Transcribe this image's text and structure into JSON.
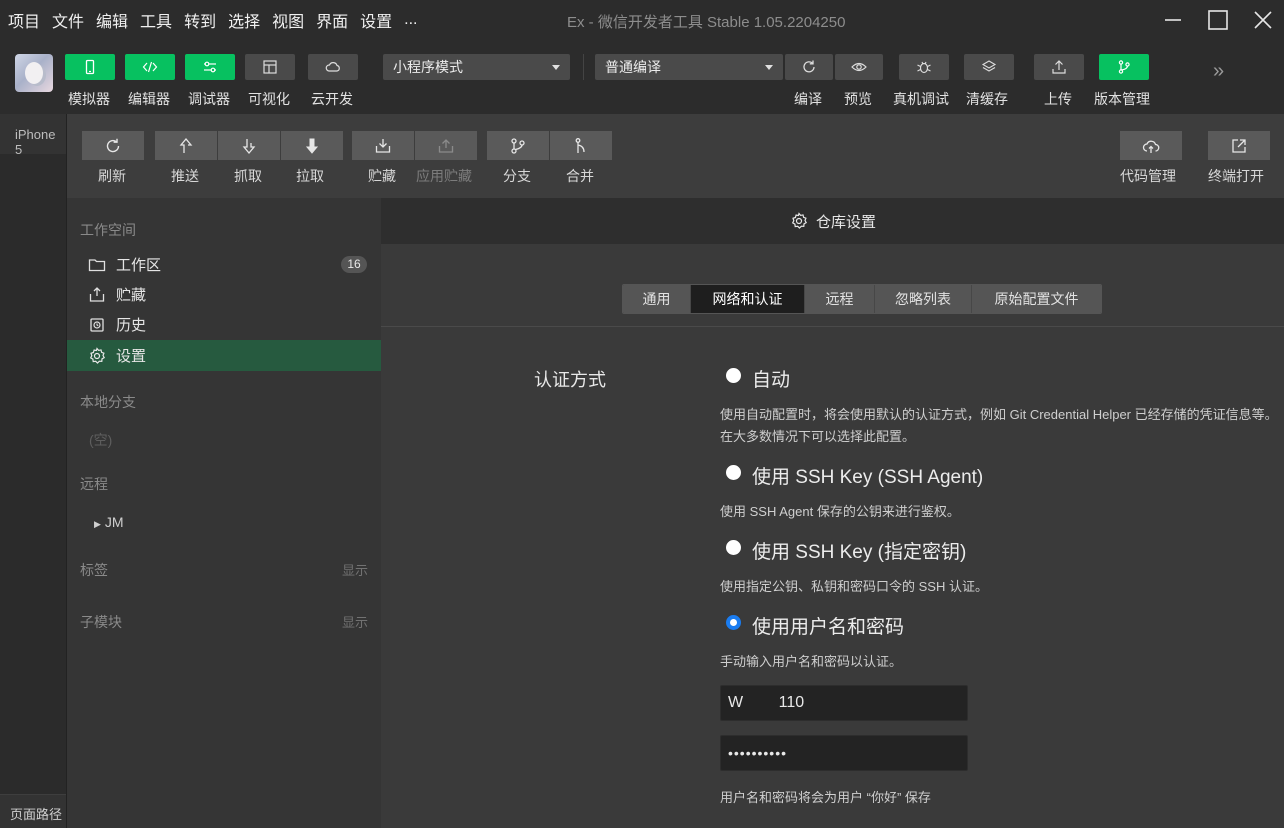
{
  "menubar": {
    "items": [
      "项目",
      "文件",
      "编辑",
      "工具",
      "转到",
      "选择",
      "视图",
      "界面",
      "设置",
      "..."
    ],
    "title": "Ex - 微信开发者工具 Stable 1.05.2204250"
  },
  "toolbar": {
    "simulator": "模拟器",
    "editor": "编辑器",
    "debugger": "调试器",
    "visual": "可视化",
    "cloud": "云开发",
    "mode_select": "小程序模式",
    "compile_select": "普通编译",
    "compile": "编译",
    "preview": "预览",
    "remote_debug": "真机调试",
    "clear_cache": "清缓存",
    "upload": "上传",
    "version_mgmt": "版本管理"
  },
  "simulator": {
    "device": "iPhone 5",
    "footer": "页面路径"
  },
  "git_toolbar": {
    "refresh": "刷新",
    "push": "推送",
    "fetch": "抓取",
    "pull": "拉取",
    "stash": "贮藏",
    "apply_stash": "应用贮藏",
    "branch": "分支",
    "merge": "合并",
    "code_mgmt": "代码管理",
    "terminal_open": "终端打开"
  },
  "sidebar": {
    "workspace_header": "工作空间",
    "items": [
      {
        "label": "工作区",
        "badge": "16"
      },
      {
        "label": "贮藏"
      },
      {
        "label": "历史"
      },
      {
        "label": "设置"
      }
    ],
    "local_branch_header": "本地分支",
    "local_branch_empty": "(空)",
    "remote_header": "远程",
    "remote_item": "JM",
    "tags_header": "标签",
    "tags_show": "显示",
    "submodule_header": "子模块",
    "submodule_show": "显示"
  },
  "content": {
    "title": "仓库设置",
    "tabs": [
      "通用",
      "网络和认证",
      "远程",
      "忽略列表",
      "原始配置文件"
    ],
    "active_tab": "网络和认证",
    "auth_label": "认证方式",
    "options": [
      {
        "label": "自动",
        "desc": "使用自动配置时，将会使用默认的认证方式，例如 Git Credential Helper 已经存储的凭证信息等。在大多数情况下可以选择此配置。",
        "checked": false
      },
      {
        "label": "使用 SSH Key (SSH Agent)",
        "desc": "使用 SSH Agent 保存的公钥来进行鉴权。",
        "checked": false
      },
      {
        "label": "使用 SSH Key (指定密钥)",
        "desc": "使用指定公钥、私钥和密码口令的 SSH 认证。",
        "checked": false
      },
      {
        "label": "使用用户名和密码",
        "desc": "手动输入用户名和密码以认证。",
        "checked": true
      }
    ],
    "username_value": "W        110",
    "password_value": "••••••••••",
    "footnote": "用户名和密码将会为用户 “你好” 保存"
  },
  "colors": {
    "accent_green": "#07c160",
    "active_sidebar": "#265a3f",
    "radio_blue": "#1a7cf0"
  }
}
